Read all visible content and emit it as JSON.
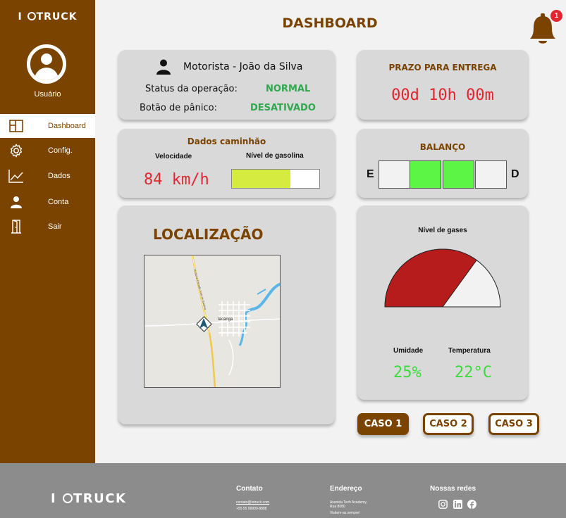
{
  "brand": {
    "logo_prefix": "I",
    "logo_suffix": "TRUCK"
  },
  "sidebar": {
    "user_label": "Usuário",
    "items": [
      {
        "label": "Dashboard",
        "icon": "layout-icon",
        "active": true
      },
      {
        "label": "Config.",
        "icon": "gear-icon"
      },
      {
        "label": "Dados",
        "icon": "chart-line-icon"
      },
      {
        "label": "Conta",
        "icon": "person-icon"
      },
      {
        "label": "Sair",
        "icon": "door-icon"
      }
    ]
  },
  "header": {
    "title": "DASHBOARD",
    "notification_count": "1"
  },
  "driver": {
    "name": "Motorista - João da Silva",
    "status_label": "Status da operação:",
    "status_value": "NORMAL",
    "panic_label": "Botão de pânico:",
    "panic_value": "DESATIVADO"
  },
  "deadline": {
    "title": "PRAZO PARA ENTREGA",
    "value": "00d 10h 00m"
  },
  "truck": {
    "title": "Dados caminhão",
    "speed_label": "Velocidade",
    "speed_value": "84 km/h",
    "fuel_label": "Nível de gasolina",
    "fuel_fraction": 0.67
  },
  "balance": {
    "title": "BALANÇO",
    "left": "E",
    "right": "D"
  },
  "location": {
    "title": "LOCALIZAÇÃO",
    "city_label": "Iacanga",
    "road_label": "Rodovia Estrada José de Saraiva"
  },
  "gases": {
    "title": "Nível de gases",
    "gauge_fraction": 0.7,
    "humidity_label": "Umidade",
    "humidity_value": "25%",
    "temp_label": "Temperatura",
    "temp_value": "22°C"
  },
  "cases": [
    "CASO 1",
    "CASO 2",
    "CASO 3"
  ],
  "footer": {
    "contact_title": "Contato",
    "contact_email": "contato@iotruck.com",
    "contact_phone": "+55 55 99999-8888",
    "address_title": "Endereço",
    "address_line1": "Avenida Tech Academy,",
    "address_line2": "Rua 8080",
    "address_line3": "Visitem-as sempre!",
    "social_title": "Nossas redes"
  },
  "colors": {
    "brand": "#7a4300",
    "alert": "#e0262e",
    "ok": "#2fa84f",
    "fuel": "#d6eb3f",
    "gauge": "#b71c1c"
  }
}
